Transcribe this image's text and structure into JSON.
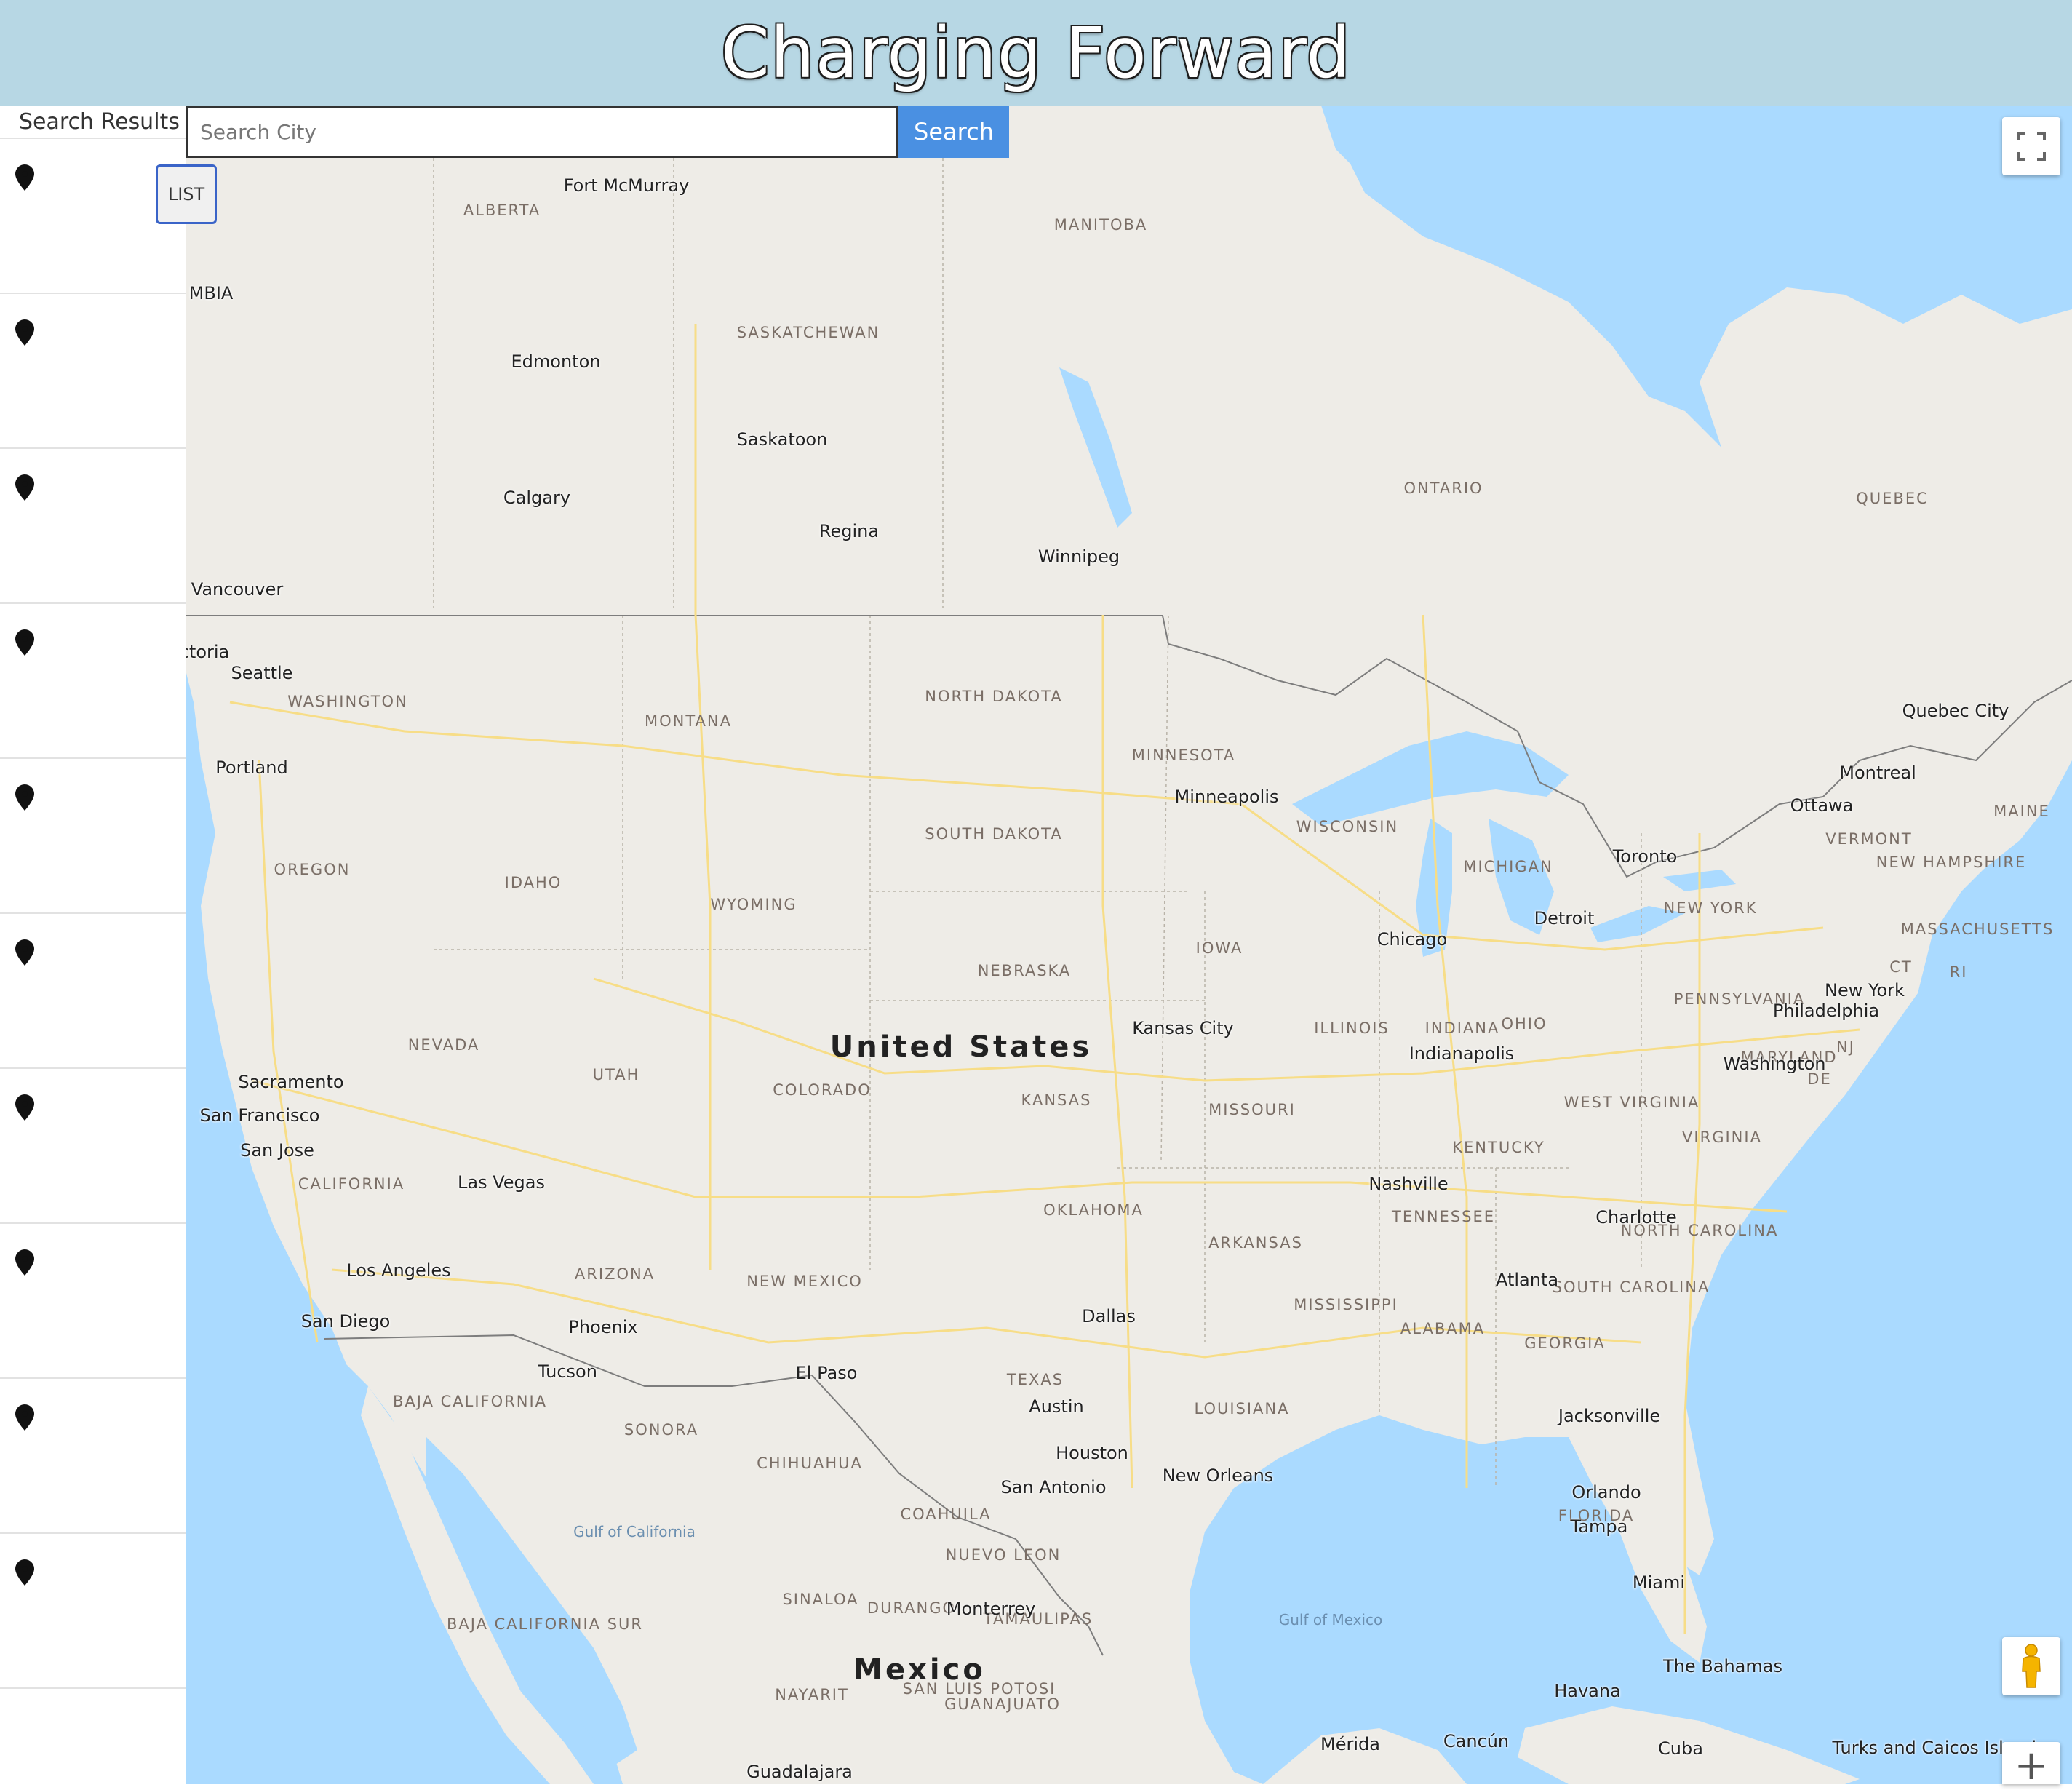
{
  "header": {
    "title": "Charging Forward"
  },
  "sidebar": {
    "title": "Search Results",
    "result_count": 10
  },
  "search": {
    "placeholder": "Search City",
    "button_label": "Search"
  },
  "map_controls": {
    "list_label": "LIST",
    "zoom_in_label": "+"
  },
  "map": {
    "country_labels": [
      "United States",
      "Mexico"
    ],
    "region_labels": [
      "ALBERTA",
      "MANITOBA",
      "SASKATCHEWAN",
      "ONTARIO",
      "QUEBEC",
      "WASHINGTON",
      "MONTANA",
      "NORTH DAKOTA",
      "MINNESOTA",
      "SOUTH DAKOTA",
      "OREGON",
      "IDAHO",
      "WYOMING",
      "WISCONSIN",
      "MICHIGAN",
      "NEW YORK",
      "VERMONT",
      "MAINE",
      "NEW HAMPSHIRE",
      "MASSACHUSETTS",
      "CT",
      "RI",
      "NEBRASKA",
      "IOWA",
      "ILLINOIS",
      "INDIANA",
      "OHIO",
      "PENNSYLVANIA",
      "NJ",
      "MARYLAND",
      "DE",
      "NEVADA",
      "UTAH",
      "COLORADO",
      "KANSAS",
      "MISSOURI",
      "WEST VIRGINIA",
      "VIRGINIA",
      "KENTUCKY",
      "CALIFORNIA",
      "TENNESSEE",
      "NORTH CAROLINA",
      "OKLAHOMA",
      "ARKANSAS",
      "ARIZONA",
      "NEW MEXICO",
      "MISSISSIPPI",
      "ALABAMA",
      "GEORGIA",
      "SOUTH CAROLINA",
      "TEXAS",
      "LOUISIANA",
      "FLORIDA",
      "BAJA CALIFORNIA",
      "SONORA",
      "CHIHUAHUA",
      "COAHUILA",
      "NUEVO LEON",
      "SINALOA",
      "DURANGO",
      "TAMAULIPAS",
      "BAJA CALIFORNIA SUR",
      "NAYARIT",
      "SAN LUIS POTOSI",
      "GUANAJUATO"
    ],
    "city_labels": [
      "Fort McMurray",
      "Edmonton",
      "Saskatoon",
      "Calgary",
      "Regina",
      "Winnipeg",
      "Vancouver",
      "ctoria",
      "Seattle",
      "Portland",
      "Quebec City",
      "Montreal",
      "Ottawa",
      "Minneapolis",
      "Toronto",
      "Detroit",
      "Chicago",
      "New York",
      "Philadelphia",
      "Washington",
      "Kansas City",
      "Indianapolis",
      "Sacramento",
      "San Francisco",
      "San Jose",
      "Las Vegas",
      "Nashville",
      "Charlotte",
      "Los Angeles",
      "San Diego",
      "Phoenix",
      "Atlanta",
      "Dallas",
      "Tucson",
      "El Paso",
      "Jacksonville",
      "Austin",
      "Houston",
      "New Orleans",
      "San Antonio",
      "Orlando",
      "Tampa",
      "Miami",
      "Monterrey",
      "Havana",
      "Mérida",
      "Cancún",
      "Cuba",
      "Guadalajara",
      "The Bahamas",
      "Turks and Caicos Islands",
      "ISH MBIA"
    ],
    "water_labels": [
      "Gulf of Mexico",
      "Gulf of California"
    ]
  },
  "colors": {
    "header_bg": "#b7d7e4",
    "search_button_bg": "#4a90e2",
    "water": "#aadaff",
    "land": "#eeece7"
  }
}
